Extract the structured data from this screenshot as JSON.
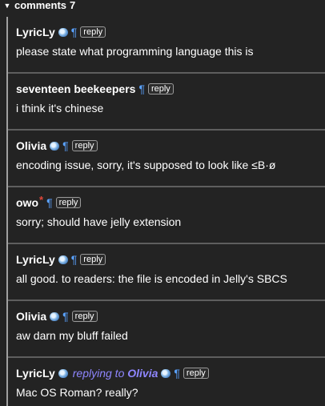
{
  "header": {
    "toggle": "▼",
    "title": "comments",
    "count": "7"
  },
  "comments": [
    {
      "author": "LyricLy",
      "badge": "moderator-badge-icon",
      "reply_label": "reply",
      "body": "please state what programming language this is"
    },
    {
      "author": "seventeen beekeepers",
      "reply_label": "reply",
      "body": "i think it's chinese"
    },
    {
      "author": "Olivia",
      "badge": "moderator-badge-icon",
      "reply_label": "reply",
      "body": "encoding issue, sorry, it's supposed to look like ≤B·ø"
    },
    {
      "author": "owo",
      "star": "*",
      "reply_label": "reply",
      "body": "sorry; should have jelly extension"
    },
    {
      "author": "LyricLy",
      "badge": "moderator-badge-icon",
      "reply_label": "reply",
      "body": "all good. to readers: the file is encoded in Jelly's SBCS"
    },
    {
      "author": "Olivia",
      "badge": "moderator-badge-icon",
      "reply_label": "reply",
      "body": "aw darn my bluff failed"
    },
    {
      "author": "LyricLy",
      "badge": "moderator-badge-icon",
      "replying_prefix": "replying to",
      "replying_to": "Olivia",
      "reply_label": "reply",
      "body": "Mac OS Roman? really?"
    }
  ],
  "pilcrow": "¶",
  "colors": {
    "background": "#232323",
    "pilcrow": "#5aa2ff",
    "replying": "#8f86ff",
    "star": "#e0473a"
  }
}
